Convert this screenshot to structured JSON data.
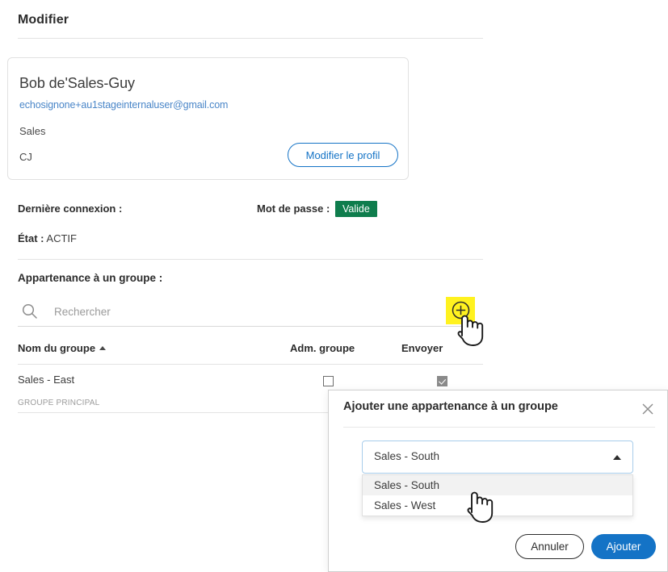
{
  "page": {
    "title": "Modifier"
  },
  "profile": {
    "name": "Bob de'Sales-Guy",
    "email": "echosignone+au1stageinternaluser@gmail.com",
    "organization": "Sales",
    "initials": "CJ",
    "edit_button_label": "Modifier le profil",
    "link_color": "#4a86c8",
    "accent_color": "#1473c6"
  },
  "meta": {
    "last_login_label": "Dernière connexion :",
    "last_login_value": "",
    "password_label": "Mot de passe :",
    "password_badge": "Valide",
    "password_badge_color": "#0f7d4d",
    "state_label": "État :",
    "state_value": "ACTIF"
  },
  "group_membership": {
    "heading": "Appartenance à un groupe :",
    "search": {
      "placeholder": "Rechercher",
      "value": "",
      "icon": "search-icon"
    },
    "add_button": {
      "icon": "plus-circle-icon",
      "highlight_color": "#fff21f"
    },
    "table": {
      "columns": [
        {
          "label": "Nom du groupe",
          "sorted": true,
          "sort_direction": "asc"
        },
        {
          "label": "Adm. groupe"
        },
        {
          "label": "Envoyer"
        }
      ],
      "rows": [
        {
          "group_name": "Sales - East",
          "tag": "GROUPE PRINCIPAL",
          "group_admin_checked": false,
          "send_checked": true
        }
      ]
    }
  },
  "modal": {
    "title": "Ajouter une appartenance à un groupe",
    "close_icon": "close-icon",
    "select": {
      "value": "Sales - South",
      "caret_icon": "chevron-up-icon",
      "expanded": true,
      "options": [
        {
          "label": "Sales - South",
          "highlighted": true
        },
        {
          "label": "Sales - West",
          "highlighted": false
        }
      ]
    },
    "cancel_label": "Annuler",
    "add_label": "Ajouter"
  }
}
